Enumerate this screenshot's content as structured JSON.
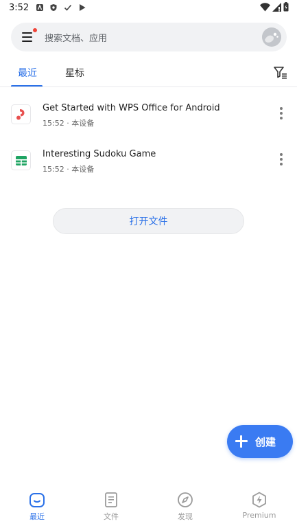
{
  "status_bar": {
    "time": "3:52",
    "icons": [
      "notification-icon",
      "shield-icon",
      "check-icon",
      "play-store-icon",
      "wifi-icon",
      "signal-icon",
      "battery-icon"
    ]
  },
  "search": {
    "placeholder": "搜索文档、应用"
  },
  "tabs": [
    {
      "label": "最近",
      "active": true
    },
    {
      "label": "星标",
      "active": false
    }
  ],
  "files": [
    {
      "name": "Get Started with WPS Office for Android",
      "meta": "15:52 · 本设备",
      "icon": "pdf-icon",
      "icon_color": "#e8504f"
    },
    {
      "name": "Interesting Sudoku Game",
      "meta": "15:52 · 本设备",
      "icon": "spreadsheet-icon",
      "icon_color": "#1fa463"
    }
  ],
  "open_file_label": "打开文件",
  "fab": {
    "label": "创建"
  },
  "bottom_nav": [
    {
      "label": "最近",
      "icon": "recent-icon",
      "active": true
    },
    {
      "label": "文件",
      "icon": "document-icon",
      "active": false
    },
    {
      "label": "发现",
      "icon": "compass-icon",
      "active": false
    },
    {
      "label": "Premium",
      "icon": "lightning-icon",
      "active": false
    }
  ],
  "colors": {
    "accent": "#2b71e8",
    "fab": "#3a7bf2",
    "notification_dot": "#f04438",
    "inactive": "#9a9a9a"
  }
}
